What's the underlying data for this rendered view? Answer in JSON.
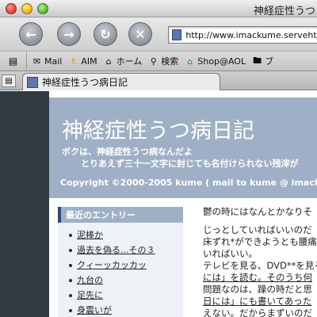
{
  "window": {
    "title": "神経症性うつ"
  },
  "navigation": {
    "back_icon": "back-arrow",
    "forward_icon": "forward-arrow",
    "reload_icon": "reload",
    "stop_icon": "stop",
    "url": "http://www.imackume.servehttp"
  },
  "bookmarks": [
    {
      "label": "Mail",
      "icon": "envelope"
    },
    {
      "label": "AIM",
      "icon": "running-man"
    },
    {
      "label": "ホーム",
      "icon": "house"
    },
    {
      "label": "検索",
      "icon": "magnifier"
    },
    {
      "label": "Shop@AOL",
      "icon": "shop"
    },
    {
      "label": "ブ",
      "icon": "folder"
    }
  ],
  "tabs": [
    {
      "label": "神経症性うつ病日記"
    }
  ],
  "site": {
    "title": "神経症性うつ病日記",
    "subtitle_line1": "ボクは、神経症性うつ病なんだよ",
    "subtitle_line2": "とりあえず三十一文字に封じても名付けられない残滓が",
    "copyright": "Copyright ©2000-2005 kume  ( mail to kume @ imackume"
  },
  "sidebar": {
    "heading": "最近のエントリー",
    "entries": [
      "泥棒か",
      "過去を偽る...その３",
      "クィーッカッカッ",
      "九台の",
      "足先に",
      "身震いが"
    ]
  },
  "main": {
    "lines": [
      "鬱の時にはなんとかなりそ",
      "",
      "じっとしていればいいのだ",
      "床ずれ*ができようとも腰痛",
      "いればいい。",
      "テレビを見る、DVD**を見る",
      "には」を読む。そのうち何",
      "問題なのは、躁の時だと思",
      "日には」にも書いてあった",
      "えない。だからまずいのだ"
    ]
  }
}
